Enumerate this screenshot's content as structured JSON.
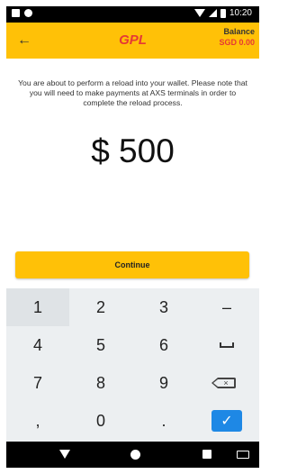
{
  "status_bar": {
    "time": "10:20"
  },
  "app_bar": {
    "back_icon": "arrow-left-icon",
    "logo": "GPL",
    "balance_label": "Balance",
    "balance_value": "SGD 0.00"
  },
  "message": "You are about to perform a reload into your wallet. Please note that you will need to make payments at AXS terminals in order to complete the reload process.",
  "amount": "$ 500",
  "continue_label": "Continue",
  "keypad": {
    "k1": "1",
    "k2": "2",
    "k3": "3",
    "minus": "–",
    "k4": "4",
    "k5": "5",
    "k6": "6",
    "space_icon": "space-bar-icon",
    "k7": "7",
    "k8": "8",
    "k9": "9",
    "backspace_icon": "backspace-icon",
    "comma": ",",
    "k0": "0",
    "period": ".",
    "done_icon": "checkmark-icon",
    "done_glyph": "✓"
  },
  "colors": {
    "app_bar": "#ffc107",
    "brand_red": "#e53935",
    "done_blue": "#1e88e5"
  }
}
